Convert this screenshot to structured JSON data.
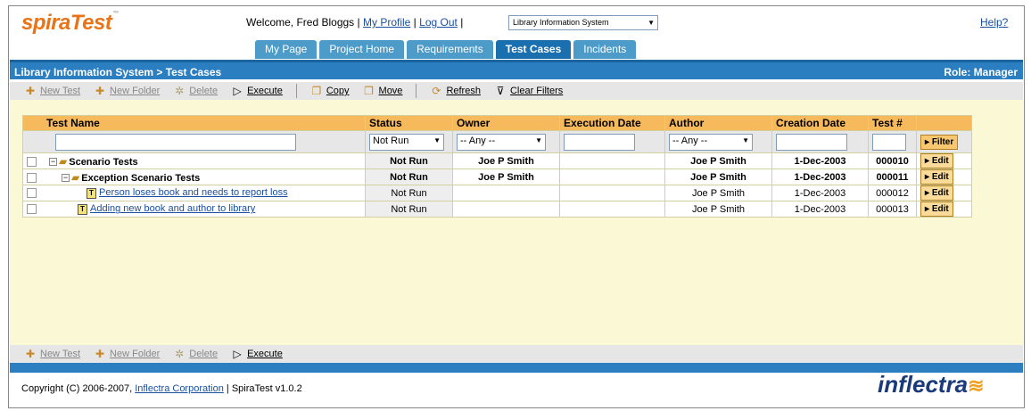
{
  "header": {
    "logo_text": "spiraTest",
    "logo_tm": "™",
    "welcome": "Welcome, Fred Bloggs",
    "my_profile": "My Profile",
    "log_out": "Log Out",
    "project_selected": "Library Information System",
    "help": "Help?",
    "sep": "|"
  },
  "tabs": [
    {
      "label": "My Page"
    },
    {
      "label": "Project Home"
    },
    {
      "label": "Requirements"
    },
    {
      "label": "Test Cases"
    },
    {
      "label": "Incidents"
    }
  ],
  "titlebar": {
    "breadcrumb": "Library Information System > Test Cases",
    "role": "Role: Manager"
  },
  "toolbar_top": {
    "new_test": "New Test",
    "new_folder": "New Folder",
    "delete": "Delete",
    "execute": "Execute",
    "copy": "Copy",
    "move": "Move",
    "refresh": "Refresh",
    "clear_filters": "Clear Filters"
  },
  "toolbar_bottom": {
    "new_test": "New Test",
    "new_folder": "New Folder",
    "delete": "Delete",
    "execute": "Execute"
  },
  "grid": {
    "columns": [
      "Test Name",
      "Status",
      "Owner",
      "Execution Date",
      "Author",
      "Creation Date",
      "Test #"
    ],
    "filters": {
      "status": "Not Run",
      "owner": "-- Any --",
      "author": "-- Any --",
      "filter_button": "Filter"
    },
    "rows": [
      {
        "name": "Scenario Tests",
        "status": "Not Run",
        "owner": "Joe P Smith",
        "exec_date": "",
        "author": "Joe P Smith",
        "created": "1-Dec-2003",
        "num": "000010",
        "edit": "Edit"
      },
      {
        "name": "Exception Scenario Tests",
        "status": "Not Run",
        "owner": "Joe P Smith",
        "exec_date": "",
        "author": "Joe P Smith",
        "created": "1-Dec-2003",
        "num": "000011",
        "edit": "Edit"
      },
      {
        "name": "Person loses book and needs to report loss",
        "status": "Not Run",
        "owner": "",
        "exec_date": "",
        "author": "Joe P Smith",
        "created": "1-Dec-2003",
        "num": "000012",
        "edit": "Edit"
      },
      {
        "name": "Adding new book and author to library",
        "status": "Not Run",
        "owner": "",
        "exec_date": "",
        "author": "Joe P Smith",
        "created": "1-Dec-2003",
        "num": "000013",
        "edit": "Edit"
      }
    ]
  },
  "footer": {
    "copyright_prefix": "Copyright (C) 2006-2007,",
    "company": "Inflectra Corporation",
    "version": "| SpiraTest v1.0.2",
    "brand": "inflectra"
  },
  "colors": {
    "header_blue": "#2b7ec0",
    "tab_blue": "#4d9bc9",
    "grid_header": "#f6ba5c",
    "content_bg": "#fbf8d6",
    "logo_orange": "#e8741a"
  }
}
